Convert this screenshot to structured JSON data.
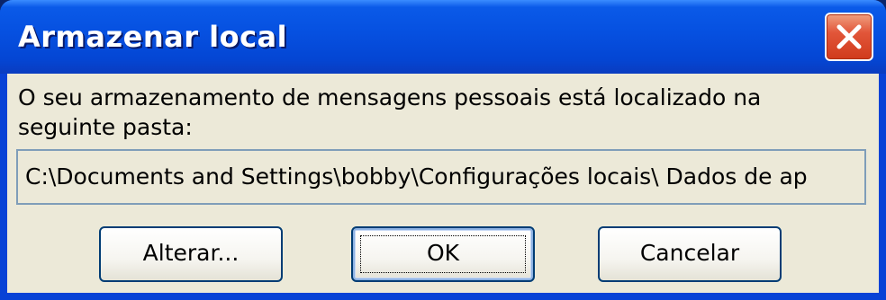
{
  "window": {
    "title": "Armazenar local"
  },
  "titlebar": {
    "close_icon": "close-icon"
  },
  "message": {
    "text": "O seu armazenamento de mensagens pessoais está localizado na seguinte pasta:"
  },
  "path_field": {
    "value": "C:\\Documents and Settings\\bobby\\Configurações locais\\ Dados de ap"
  },
  "buttons": {
    "change_label": "Alterar...",
    "ok_label": "OK",
    "cancel_label": "Cancelar"
  },
  "colors": {
    "titlebar": "#0650e0",
    "client_background": "#ece9d8",
    "close_button": "#e2563a",
    "field_border": "#7f9db9"
  }
}
